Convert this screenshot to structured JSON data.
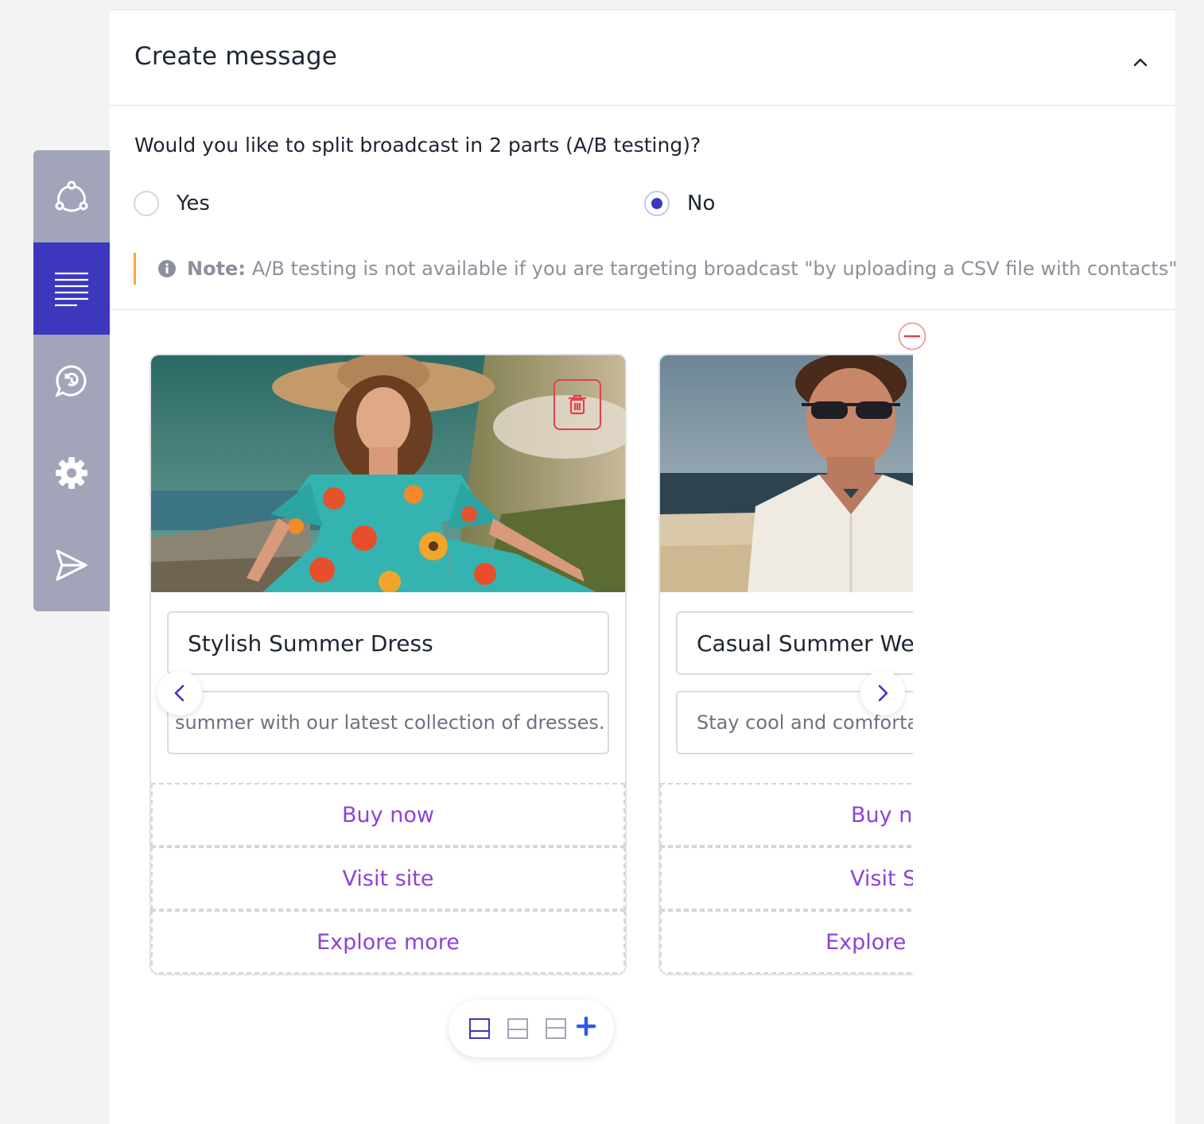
{
  "sidebar": {
    "items": [
      {
        "icon": "share-nodes-icon",
        "active": false
      },
      {
        "icon": "text-lines-icon",
        "active": true
      },
      {
        "icon": "whatsapp-icon",
        "active": false
      },
      {
        "icon": "gear-icon",
        "active": false
      },
      {
        "icon": "send-icon",
        "active": false
      }
    ]
  },
  "panel": {
    "title": "Create message"
  },
  "ab_test": {
    "question": "Would you like to split broadcast in 2 parts (A/B testing)?",
    "options": [
      {
        "label": "Yes",
        "checked": false
      },
      {
        "label": "No",
        "checked": true
      }
    ],
    "note_label": "Note:",
    "note_text": "A/B testing is not available if you are targeting broadcast \"by uploading a CSV file with contacts\""
  },
  "carousel": {
    "cards": [
      {
        "title": "Stylish Summer Dress",
        "description": "summer with our latest collection of dresses.",
        "buttons": [
          "Buy now",
          "Visit site",
          "Explore more"
        ]
      },
      {
        "title": "Casual Summer Wear",
        "description": "Stay cool and comfortable",
        "buttons": [
          "Buy now",
          "Visit Site",
          "Explore more"
        ]
      }
    ]
  },
  "colors": {
    "accent": "#3d37bd",
    "button_text": "#8c43d6",
    "delete": "#e4404d",
    "note_border": "#f5a742",
    "add_blue": "#2b5ce6"
  }
}
